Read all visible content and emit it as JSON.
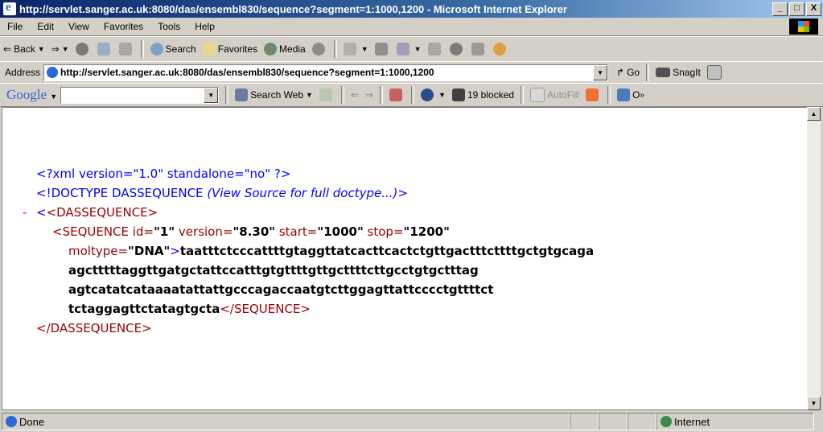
{
  "window": {
    "title": "http://servlet.sanger.ac.uk:8080/das/ensembl830/sequence?segment=1:1000,1200 - Microsoft Internet Explorer",
    "minimize": "_",
    "maximize": "□",
    "close": "X"
  },
  "menu": [
    "File",
    "Edit",
    "View",
    "Favorites",
    "Tools",
    "Help"
  ],
  "toolbar": {
    "back": "Back",
    "search": "Search",
    "favorites": "Favorites",
    "media": "Media"
  },
  "address": {
    "label": "Address",
    "url": "http://servlet.sanger.ac.uk:8080/das/ensembl830/sequence?segment=1:1000,1200",
    "go": "Go",
    "snagit": "SnagIt"
  },
  "google": {
    "logo": "Google",
    "search_web": "Search Web",
    "blocked": "19 blocked",
    "autofill": "AutoFill",
    "more": "O"
  },
  "xml": {
    "pi": "<?xml version=\"1.0\" standalone=\"no\" ?>",
    "doctype_open": "<!DOCTYPE DASSEQUENCE ",
    "doctype_note": "(View Source for full doctype...)",
    "doctype_close": ">",
    "collapse": "-",
    "dasseq_open": "<DASSEQUENCE>",
    "seq_tag_open": "<SEQUENCE",
    "attr_id": "id=",
    "id_value": "\"1\"",
    "attr_version": "version=",
    "version_value": "\"8.30\"",
    "attr_start": "start=",
    "start_value": "\"1000\"",
    "attr_stop": "stop=",
    "stop_value": "\"1200\"",
    "attr_moltype": "moltype=",
    "moltype_value": "\"DNA\"",
    "seq_gt": ">",
    "seq_line1": "taatttctcccattttgtaggttatcacttcactctgttgactttcttttgctgtgcaga",
    "seq_line2": "agctttttaggttgatgctattccatttgtgttttgttgcttttcttgcctgtgctttag",
    "seq_line3": "agtcatatcataaaatattattgcccagaccaatgtcttggagttattcccctgttttct",
    "seq_line4": "tctaggagttctatagtgcta",
    "seq_close": "</SEQUENCE>",
    "dasseq_close": "</DASSEQUENCE>"
  },
  "status": {
    "text": "Done",
    "zone": "Internet"
  }
}
